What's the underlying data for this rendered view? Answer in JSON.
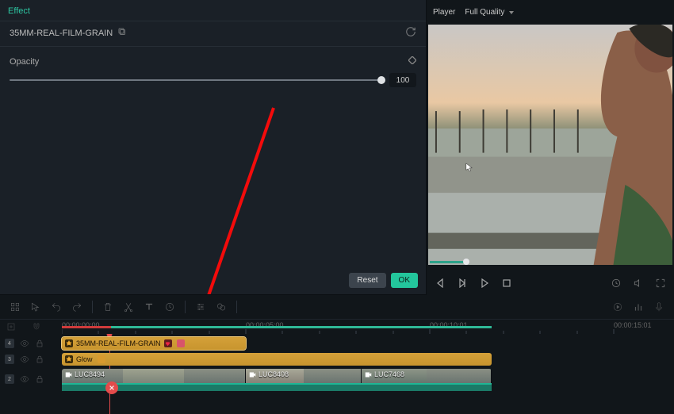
{
  "panel": {
    "tab_label": "Effect",
    "effect_name": "35MM-REAL-FILM-GRAIN",
    "opacity_label": "Opacity",
    "opacity_value": "100",
    "reset_label": "Reset",
    "ok_label": "OK"
  },
  "player": {
    "player_label": "Player",
    "quality_label": "Full Quality"
  },
  "timeline": {
    "timecodes": [
      "00:00:00:00",
      "00:00:05:00",
      "00:00:10:01",
      "00:00:15:01"
    ],
    "tracks": {
      "fx1": {
        "layer": "4",
        "clip_name": "35MM-REAL-FILM-GRAIN",
        "clip_width": 232
      },
      "fx2": {
        "layer": "3",
        "clip_name": "Glow",
        "clip_width": 542
      },
      "video": {
        "layer": "2",
        "clips": [
          "LUC8494",
          "LUC8408",
          "LUC7468"
        ]
      }
    }
  },
  "colors": {
    "accent": "#23c69c",
    "clip": "#d4a039",
    "playhead": "#e44b4b"
  }
}
